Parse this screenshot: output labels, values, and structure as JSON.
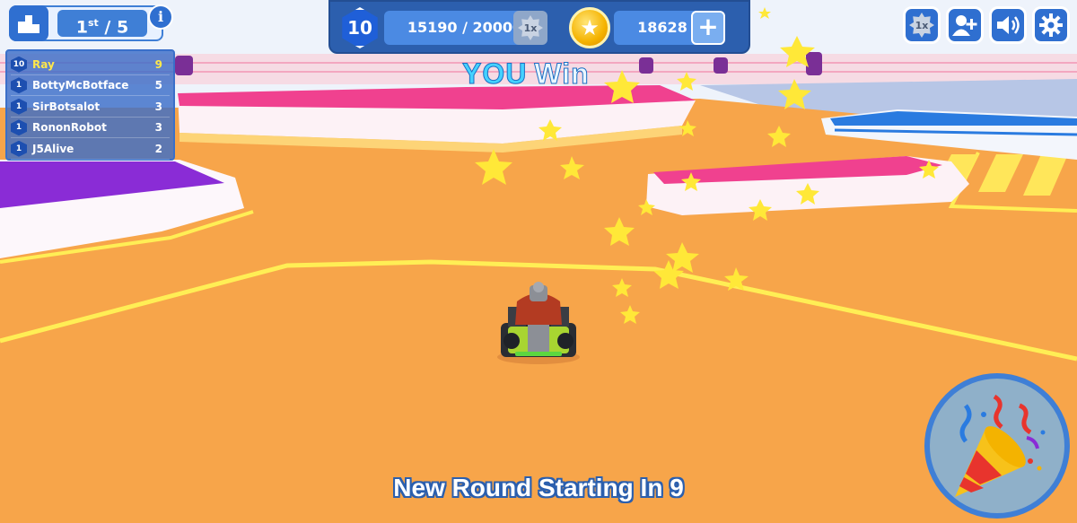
{
  "hud": {
    "rank": {
      "place": "1",
      "suffix": "st",
      "separator": "/",
      "total": "5"
    },
    "info_label": "i"
  },
  "leaderboard": [
    {
      "level": "10",
      "name": "Ray",
      "score": "9",
      "highlight": true
    },
    {
      "level": "1",
      "name": "BottyMcBotface",
      "score": "5"
    },
    {
      "level": "1",
      "name": "SirBotsalot",
      "score": "3"
    },
    {
      "level": "1",
      "name": "RononRobot",
      "score": "3"
    },
    {
      "level": "1",
      "name": "J5Alive",
      "score": "2"
    }
  ],
  "topbar": {
    "level": "10",
    "xp": "15190 / 20000",
    "xp_progress": 0.7595,
    "xp_multiplier": "1x",
    "coins": "18628",
    "add_coins_label": "+"
  },
  "top_right": {
    "multiplier": "1x",
    "buttons": [
      "multiplier-icon",
      "add-friend-icon",
      "sound-icon",
      "settings-gear-icon"
    ]
  },
  "message": {
    "win_you": "YOU",
    "win_word": "Win",
    "round": "New Round Starting In 9"
  },
  "colors": {
    "ui_blue": "#3f7fd6",
    "ground_orange": "#f7a54a",
    "accent_yellow": "#ffe84a",
    "pink_block": "#f0418f",
    "purple_block": "#8a2cd6"
  }
}
